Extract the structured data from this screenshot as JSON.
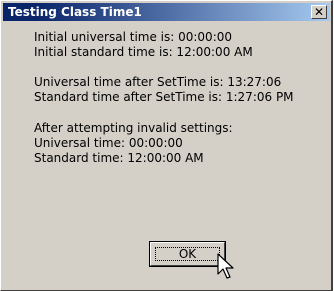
{
  "window": {
    "title": "Testing Class Time1",
    "close_symbol": "✕"
  },
  "message": {
    "line1": "Initial universal time is: 00:00:00",
    "line2": "Initial standard time is: 12:00:00 AM",
    "line3": "Universal time after SetTime is: 13:27:06",
    "line4": "Standard time after SetTime is: 1:27:06 PM",
    "line5": "After attempting invalid settings:",
    "line6": "Universal time: 00:00:00",
    "line7": "Standard time: 12:00:00 AM"
  },
  "buttons": {
    "ok_label": "OK"
  },
  "icons": {
    "close": "close-icon",
    "cursor": "mouse-pointer-icon"
  }
}
